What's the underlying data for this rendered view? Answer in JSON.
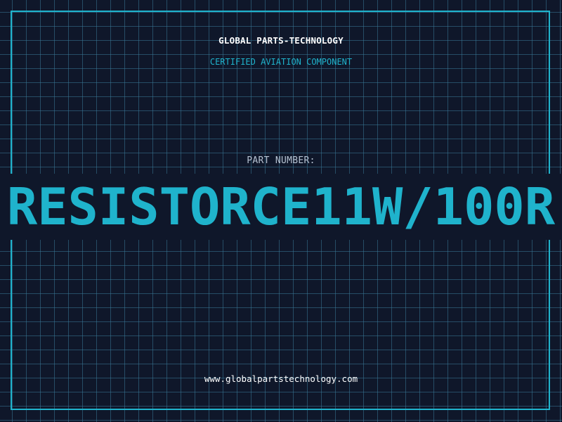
{
  "header": {
    "company": "GLOBAL PARTS-TECHNOLOGY",
    "tagline": "CERTIFIED AVIATION COMPONENT"
  },
  "part": {
    "label": "PART NUMBER:",
    "number": "RESISTORCE11W/100R"
  },
  "footer": {
    "url": "www.globalpartstechnology.com"
  },
  "colors": {
    "background": "#0f172a",
    "accent": "#1fb3cc",
    "grid": "#387896",
    "text": "#ffffff",
    "muted": "#b6c2d2"
  }
}
